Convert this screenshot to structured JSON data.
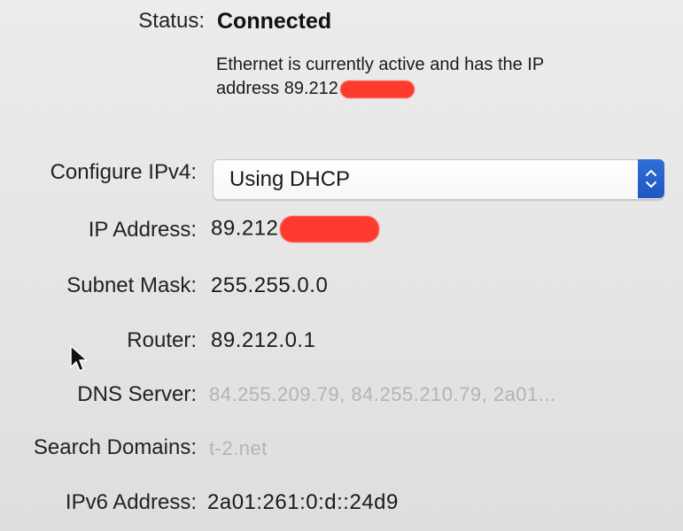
{
  "status": {
    "label": "Status:",
    "value": "Connected",
    "description_line1": "Ethernet is currently active and has the IP",
    "description_line2_prefix": "address 89.212"
  },
  "configure_ipv4": {
    "label": "Configure IPv4:",
    "selected_value": "Using DHCP"
  },
  "ip_address": {
    "label": "IP Address:",
    "value_prefix": "89.212"
  },
  "subnet_mask": {
    "label": "Subnet Mask:",
    "value": "255.255.0.0"
  },
  "router": {
    "label": "Router:",
    "value": "89.212.0.1"
  },
  "dns_server": {
    "label": "DNS Server:",
    "value": "84.255.209.79, 84.255.210.79, 2a01..."
  },
  "search_domains": {
    "label": "Search Domains:",
    "value": "t-2.net"
  },
  "ipv6_address": {
    "label": "IPv6 Address:",
    "value": "2a01:261:0:d::24d9"
  },
  "colors": {
    "redaction": "#ff3b30",
    "stepper_blue": "#1f57c0",
    "dim_text": "#b4b4b4"
  },
  "icons": {
    "popup_stepper": "up-down-chevron-icon",
    "cursor": "mouse-pointer-icon"
  }
}
